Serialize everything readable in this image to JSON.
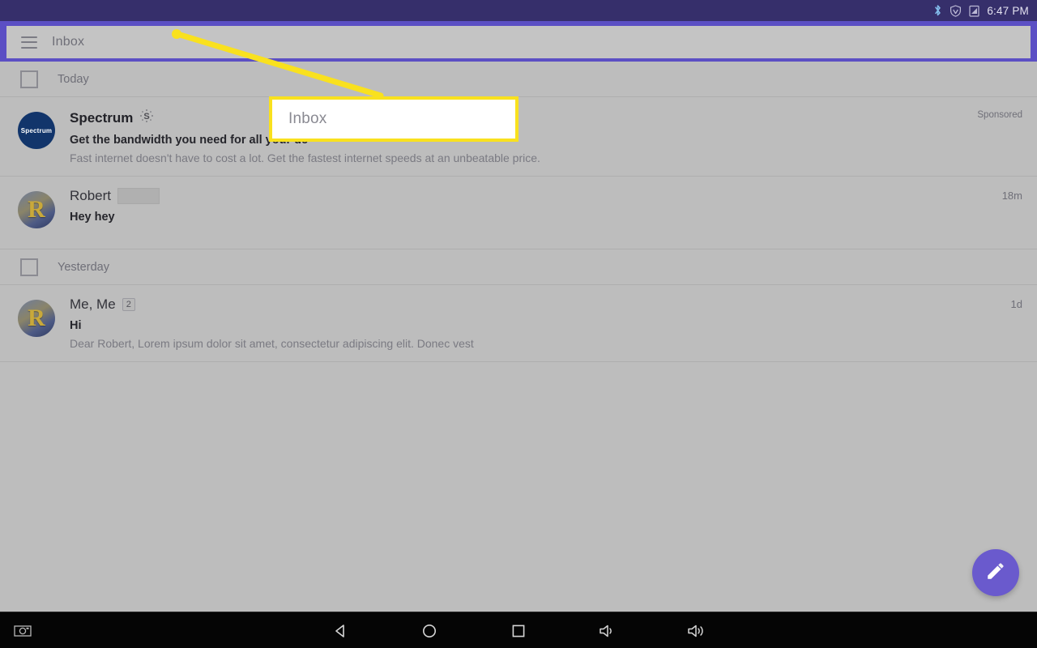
{
  "status_bar": {
    "icons": [
      "bluetooth-icon",
      "vpn-shield-icon",
      "battery-icon"
    ],
    "time": "6:47 PM"
  },
  "app_bar": {
    "menu_icon": "hamburger-menu-icon",
    "title": "Inbox"
  },
  "callout": {
    "text": "Inbox",
    "border_color": "#f9e11e",
    "background": "#ffffff"
  },
  "sections": [
    {
      "label": "Today",
      "checkbox_checked": false,
      "rows": [
        {
          "avatar_type": "logo",
          "avatar_text": "Spectrum",
          "sender": "Spectrum",
          "ad_icon": "sponsored-dollar-icon",
          "subject": "Get the bandwidth you need for all your de",
          "snippet": "Fast internet doesn't have to cost a lot. Get the fastest internet speeds at an unbeatable price.",
          "timestamp": "Sponsored",
          "bold": true,
          "redacted": false,
          "count": null
        },
        {
          "avatar_type": "photo",
          "avatar_text": "R",
          "sender": "Robert",
          "ad_icon": null,
          "subject": "Hey hey",
          "snippet": "",
          "timestamp": "18m",
          "bold": true,
          "redacted": true,
          "count": null
        }
      ]
    },
    {
      "label": "Yesterday",
      "checkbox_checked": false,
      "rows": [
        {
          "avatar_type": "photo",
          "avatar_text": "R",
          "sender": "Me, Me",
          "ad_icon": null,
          "subject": "Hi",
          "snippet": "Dear Robert, Lorem ipsum dolor sit amet, consectetur adipiscing elit. Donec vest",
          "timestamp": "1d",
          "bold": false,
          "redacted": false,
          "count": "2"
        }
      ]
    }
  ],
  "fab": {
    "icon": "compose-pencil-icon",
    "color": "#6a5acd"
  },
  "nav_bar": {
    "buttons": [
      {
        "name": "screenshot-icon"
      },
      {
        "name": "back-icon"
      },
      {
        "name": "home-icon"
      },
      {
        "name": "recents-icon"
      },
      {
        "name": "volume-down-icon"
      },
      {
        "name": "volume-up-icon"
      }
    ]
  },
  "colors": {
    "status_bar": "#362f6b",
    "app_bar_frame": "#5b4fc4",
    "app_bar": "#c4c4c4",
    "list_background": "#bdbdbd",
    "highlight": "#f9e11e"
  }
}
